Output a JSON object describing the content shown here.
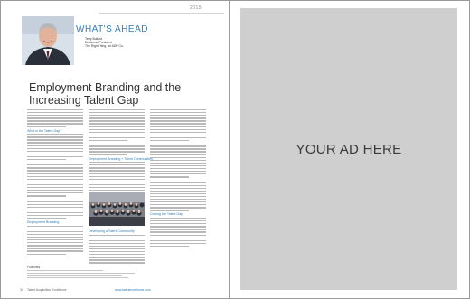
{
  "article": {
    "year": "2015",
    "kicker": "WHAT'S AHEAD",
    "author": {
      "name": "Terry Bullard",
      "role": "Divisional President",
      "company": "The RightThing, an ADP Co."
    },
    "title_line1": "Employment Branding and the",
    "title_line2": "Increasing Talent Gap",
    "headings": {
      "h1": "What is the Talent Gap?",
      "h2": "Employment Branding",
      "h3": "Employment Branding + Talent Communities",
      "h4": "Developing a Talent Community",
      "h5": "Closing the Talent Gap"
    },
    "footnotes_label": "Footnotes",
    "footer": {
      "page_number": "34",
      "publication": "Talent Acquisition Excellence",
      "url": "www.talentexcellence.com"
    }
  },
  "ad": {
    "text": "YOUR AD HERE"
  },
  "colors": {
    "accent": "#2f7fb8",
    "ad_background": "#cfcfcf",
    "text_gray": "#b8b8b8"
  }
}
